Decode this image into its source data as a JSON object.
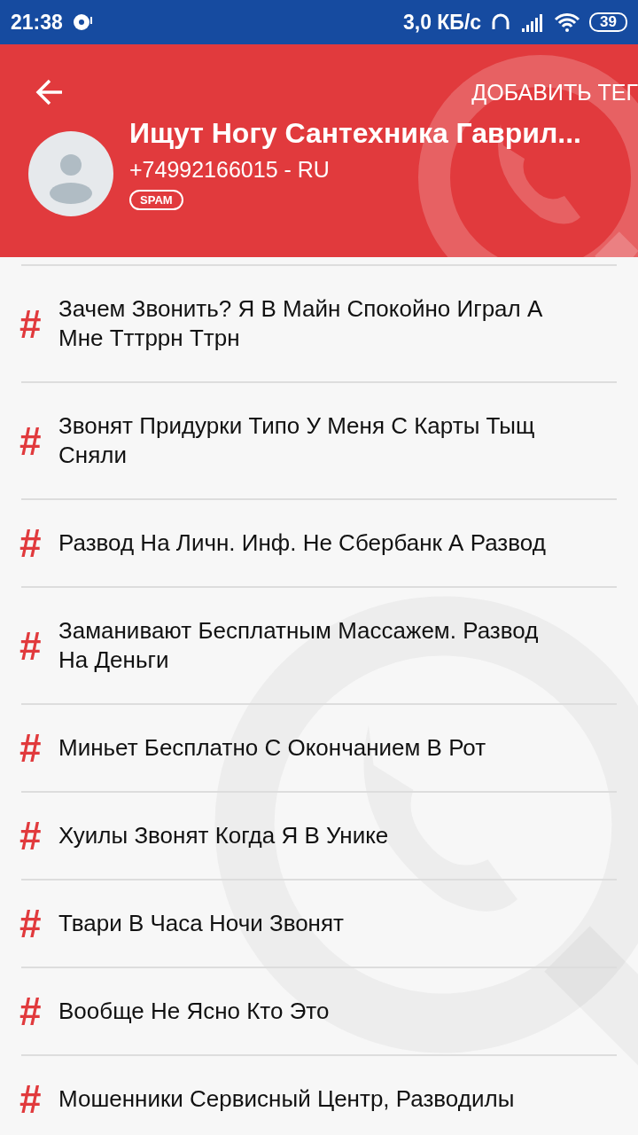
{
  "status_bar": {
    "time": "21:38",
    "speed": "3,0 КБ/с",
    "battery": "39"
  },
  "header": {
    "action": "ДОБАВИТЬ ТЕГ",
    "title": "Ищут Ногу Сантехника Гаврил...",
    "phone": "+74992166015 - RU",
    "badge": "SPAM"
  },
  "tags": [
    {
      "mark": "#",
      "text": "Зачем Звонить? Я В Майн Спокойно Играл А Мне Тттррн Ттрн"
    },
    {
      "mark": "#",
      "text": "Звонят Придурки Типо У Меня С Карты Тыщ Сняли"
    },
    {
      "mark": "#",
      "text": "Развод На Личн. Инф. Не Сбербанк А Развод"
    },
    {
      "mark": "#",
      "text": "Заманивают Бесплатным Массажем. Развод На Деньги"
    },
    {
      "mark": "#",
      "text": "Миньет Бесплатно С Окончанием В Рот"
    },
    {
      "mark": "#",
      "text": "Хуилы Звонят Когда Я В Унике"
    },
    {
      "mark": "#",
      "text": "Твари В Часа Ночи Звонят"
    },
    {
      "mark": "#",
      "text": "Вообще Не Ясно Кто Это"
    },
    {
      "mark": "#",
      "text": "Мошенники Сервисный Центр, Разводилы"
    }
  ]
}
